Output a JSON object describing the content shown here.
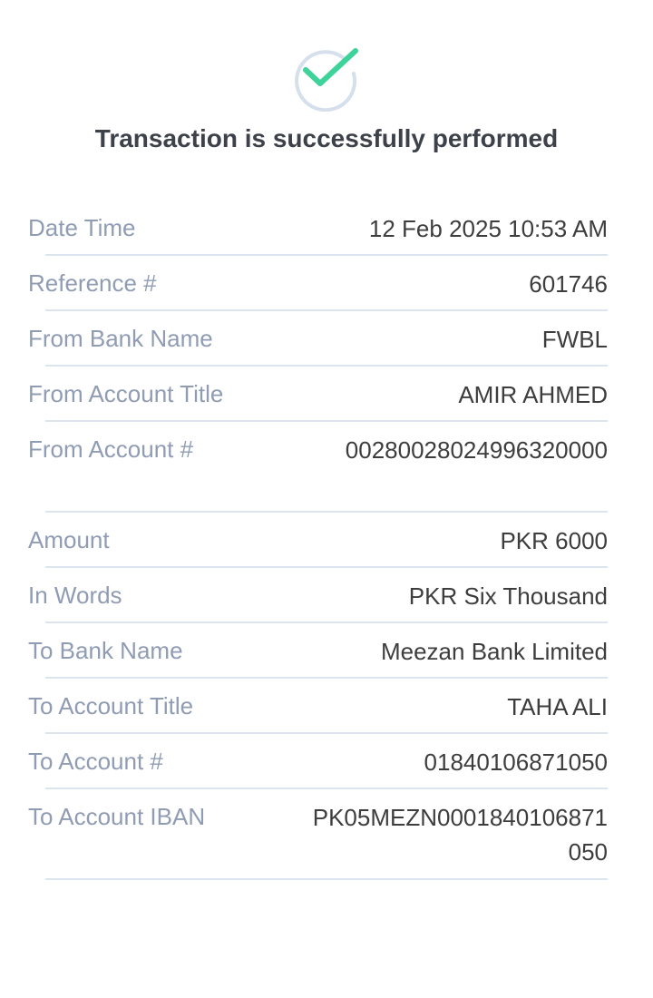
{
  "status": {
    "icon": "check-circle-icon",
    "success_color": "#3ed39a",
    "ring_color": "#d6e0ec",
    "title": "Transaction is successfully performed"
  },
  "details": [
    {
      "label": "Date Time",
      "value": "12 Feb 2025 10:53 AM"
    },
    {
      "label": "Reference #",
      "value": "601746"
    },
    {
      "label": "From Bank Name",
      "value": "FWBL"
    },
    {
      "label": "From Account Title",
      "value": "AMIR AHMED"
    },
    {
      "label": "From Account #",
      "value": "00280028024996320000"
    },
    {
      "label": "Amount",
      "value": "PKR 6000"
    },
    {
      "label": "In Words",
      "value": "PKR Six Thousand"
    },
    {
      "label": "To Bank Name",
      "value": "Meezan Bank Limited"
    },
    {
      "label": "To Account Title",
      "value": "TAHA ALI"
    },
    {
      "label": "To Account #",
      "value": "01840106871050"
    },
    {
      "label": "To Account IBAN",
      "value": "PK05MEZN0001840106871050"
    }
  ]
}
